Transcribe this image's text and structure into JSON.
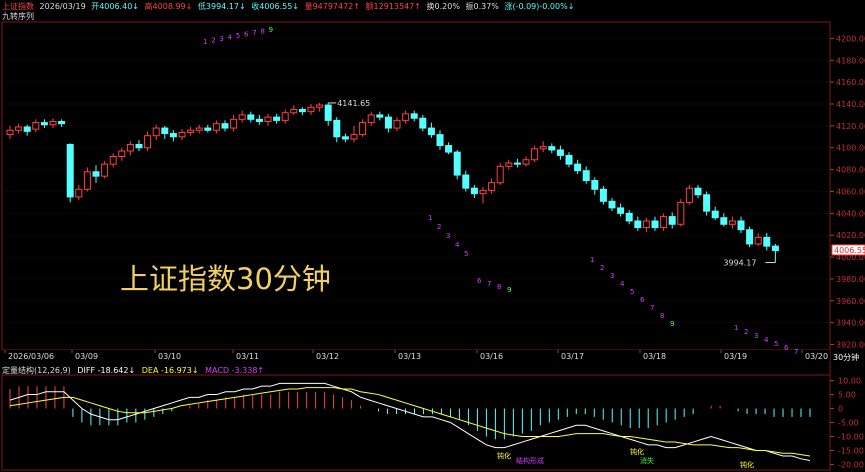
{
  "header": {
    "name": "上证指数",
    "date": "2026/03/19",
    "open": "开4006.40↓",
    "high": "高4008.99↓",
    "low": "低3994.17↓",
    "close": "收4006.55↓",
    "volume": "量94797472↑",
    "amount": "额12913547↑",
    "turnover": "换0.20%",
    "amplitude": "振0.37%",
    "change": "涨(-0.09)-0.00%↓"
  },
  "indicator_name": "九转序列",
  "overlay_title": "上证指数30分钟",
  "price_axis": [
    "4200.00",
    "4180.00",
    "4160.00",
    "4140.00",
    "4120.00",
    "4100.00",
    "4080.00",
    "4060.00",
    "4040.00",
    "4020.00",
    "4000.00",
    "3980.00",
    "3960.00",
    "3940.00",
    "3920.00"
  ],
  "current_price_tag": "4006.55",
  "high_label": "4141.65",
  "low_label": "3994.17",
  "date_axis": [
    "2026/03/06",
    "03/09",
    "03/10",
    "03/11",
    "03/12",
    "03/13",
    "03/16",
    "03/17",
    "03/18",
    "03/19",
    "03/20"
  ],
  "period_button": "30分钟",
  "macd": {
    "name": "定量结构(12,26,9)",
    "diff": "DIFF -18.642↓",
    "dea": "DEA -16.973↓",
    "macd": "MACD -3.338↑",
    "axis": [
      "10.00",
      "5.00",
      "0",
      "-5.00",
      "-10.00",
      "-15.00",
      "-20.00"
    ],
    "annotations": [
      "钝化",
      "结构形成",
      "钝化",
      "消失",
      "钝化"
    ]
  },
  "seq_digits": [
    "1",
    "2",
    "3",
    "4",
    "5",
    "6",
    "7",
    "8",
    "9"
  ],
  "colors": {
    "up": "#ff4040",
    "down": "#54ffff",
    "diff": "#ffffff",
    "dea": "#ffff40",
    "grid": "#7a1a1a",
    "axis_text": "#c03030",
    "seq_purple": "#d040ff",
    "seq_green": "#40ff40"
  },
  "chart_data": {
    "type": "candlestick",
    "y_range": [
      3915,
      4215
    ],
    "candles": [
      [
        4112,
        4116,
        4108,
        4120
      ],
      [
        4116,
        4119,
        4113,
        4122
      ],
      [
        4119,
        4115,
        4111,
        4121
      ],
      [
        4117,
        4123,
        4114,
        4126
      ],
      [
        4123,
        4121,
        4118,
        4126
      ],
      [
        4121,
        4124,
        4118,
        4127
      ],
      [
        4124,
        4122,
        4119,
        4126
      ],
      [
        4103,
        4055,
        4050,
        4104
      ],
      [
        4055,
        4062,
        4052,
        4066
      ],
      [
        4062,
        4078,
        4060,
        4082
      ],
      [
        4078,
        4074,
        4068,
        4084
      ],
      [
        4074,
        4085,
        4072,
        4088
      ],
      [
        4085,
        4092,
        4082,
        4095
      ],
      [
        4092,
        4097,
        4088,
        4100
      ],
      [
        4097,
        4103,
        4093,
        4106
      ],
      [
        4103,
        4100,
        4097,
        4107
      ],
      [
        4100,
        4111,
        4097,
        4115
      ],
      [
        4111,
        4118,
        4107,
        4121
      ],
      [
        4118,
        4113,
        4108,
        4120
      ],
      [
        4113,
        4110,
        4106,
        4116
      ],
      [
        4110,
        4114,
        4107,
        4117
      ],
      [
        4114,
        4116,
        4111,
        4119
      ],
      [
        4116,
        4118,
        4113,
        4121
      ],
      [
        4118,
        4116,
        4114,
        4121
      ],
      [
        4116,
        4122,
        4113,
        4125
      ],
      [
        4122,
        4118,
        4115,
        4125
      ],
      [
        4118,
        4126,
        4115,
        4130
      ],
      [
        4126,
        4130,
        4123,
        4134
      ],
      [
        4130,
        4126,
        4123,
        4133
      ],
      [
        4126,
        4124,
        4121,
        4130
      ],
      [
        4124,
        4128,
        4120,
        4131
      ],
      [
        4128,
        4125,
        4122,
        4131
      ],
      [
        4125,
        4132,
        4122,
        4135
      ],
      [
        4132,
        4135,
        4130,
        4139
      ],
      [
        4135,
        4133,
        4130,
        4137
      ],
      [
        4133,
        4137,
        4130,
        4140
      ],
      [
        4137,
        4139,
        4133,
        4141
      ],
      [
        4139,
        4125,
        4120,
        4141
      ],
      [
        4125,
        4110,
        4105,
        4128
      ],
      [
        4110,
        4108,
        4105,
        4113
      ],
      [
        4108,
        4112,
        4105,
        4120
      ],
      [
        4112,
        4123,
        4110,
        4126
      ],
      [
        4123,
        4130,
        4120,
        4133
      ],
      [
        4130,
        4128,
        4125,
        4133
      ],
      [
        4128,
        4118,
        4114,
        4131
      ],
      [
        4118,
        4125,
        4115,
        4128
      ],
      [
        4125,
        4131,
        4122,
        4134
      ],
      [
        4131,
        4127,
        4124,
        4134
      ],
      [
        4127,
        4118,
        4115,
        4130
      ],
      [
        4118,
        4112,
        4109,
        4123
      ],
      [
        4112,
        4102,
        4098,
        4116
      ],
      [
        4102,
        4096,
        4094,
        4105
      ],
      [
        4096,
        4075,
        4071,
        4098
      ],
      [
        4075,
        4063,
        4060,
        4079
      ],
      [
        4063,
        4058,
        4054,
        4066
      ],
      [
        4058,
        4061,
        4049,
        4064
      ],
      [
        4061,
        4068,
        4058,
        4072
      ],
      [
        4068,
        4083,
        4066,
        4086
      ],
      [
        4083,
        4086,
        4080,
        4089
      ],
      [
        4086,
        4085,
        4082,
        4090
      ],
      [
        4085,
        4089,
        4083,
        4092
      ],
      [
        4089,
        4099,
        4087,
        4102
      ],
      [
        4099,
        4101,
        4096,
        4106
      ],
      [
        4101,
        4098,
        4095,
        4104
      ],
      [
        4098,
        4093,
        4089,
        4102
      ],
      [
        4093,
        4085,
        4082,
        4096
      ],
      [
        4085,
        4079,
        4076,
        4089
      ],
      [
        4079,
        4070,
        4067,
        4083
      ],
      [
        4070,
        4062,
        4057,
        4073
      ],
      [
        4062,
        4051,
        4048,
        4065
      ],
      [
        4051,
        4045,
        4042,
        4054
      ],
      [
        4045,
        4040,
        4037,
        4049
      ],
      [
        4040,
        4033,
        4030,
        4043
      ],
      [
        4033,
        4027,
        4024,
        4037
      ],
      [
        4027,
        4033,
        4023,
        4036
      ],
      [
        4033,
        4027,
        4024,
        4037
      ],
      [
        4027,
        4037,
        4024,
        4040
      ],
      [
        4037,
        4030,
        4026,
        4041
      ],
      [
        4030,
        4050,
        4028,
        4053
      ],
      [
        4050,
        4063,
        4048,
        4066
      ],
      [
        4063,
        4057,
        4054,
        4066
      ],
      [
        4057,
        4042,
        4038,
        4060
      ],
      [
        4042,
        4036,
        4034,
        4046
      ],
      [
        4036,
        4030,
        4028,
        4040
      ],
      [
        4030,
        4033,
        4026,
        4037
      ],
      [
        4033,
        4025,
        4022,
        4037
      ],
      [
        4025,
        4012,
        4009,
        4028
      ],
      [
        4012,
        4018,
        4010,
        4022
      ],
      [
        4018,
        4010,
        4006,
        4022
      ],
      [
        4010,
        4006,
        3995,
        4012
      ]
    ],
    "seq_groups": [
      {
        "start_index": 29,
        "digits": 9,
        "y_price": 4200,
        "color_last": "green"
      },
      {
        "start_index": 68,
        "digits": 9,
        "y_price": 4028,
        "color_last": "green"
      },
      {
        "start_index": 95,
        "digits": 9,
        "y_price": 3992,
        "color_last": "green"
      },
      {
        "start_index": 131,
        "digits": 7,
        "y_price": 3938,
        "color_last": "purple"
      }
    ],
    "macd_hist": [
      7,
      8,
      8,
      8,
      8,
      8,
      8,
      -3,
      -5,
      -6,
      -6,
      -6,
      -6,
      -5,
      -5,
      -4,
      -3,
      -2,
      -1,
      0,
      1,
      2,
      3,
      3,
      4,
      4,
      5,
      5,
      5,
      5,
      6,
      6,
      6,
      6,
      6,
      6,
      5,
      4,
      3,
      1,
      0,
      -1,
      -2,
      -2,
      -2,
      -2,
      -2,
      -2,
      -2,
      -3,
      -4,
      -6,
      -8,
      -10,
      -11,
      -11,
      -10,
      -9,
      -8,
      -6,
      -5,
      -4,
      -3,
      -2,
      -2,
      -3,
      -4,
      -5,
      -6,
      -7,
      -7,
      -7,
      -6,
      -5,
      -4,
      -3,
      -2,
      0,
      1,
      1,
      0,
      -1,
      -2,
      -2,
      -2,
      -3,
      -3,
      -3,
      -3,
      -3
    ],
    "diff": [
      3,
      4,
      5,
      5,
      6,
      6,
      6,
      3,
      0,
      -2,
      -3,
      -4,
      -4,
      -3,
      -2,
      -1,
      0,
      1,
      2,
      3,
      4,
      4,
      5,
      5,
      6,
      6,
      7,
      7,
      8,
      8,
      9,
      9,
      9,
      9,
      9,
      9,
      8,
      7,
      6,
      4,
      3,
      2,
      1,
      0,
      -1,
      -2,
      -3,
      -3,
      -4,
      -5,
      -7,
      -9,
      -11,
      -13,
      -14,
      -14,
      -13,
      -12,
      -11,
      -10,
      -9,
      -8,
      -7,
      -6,
      -6,
      -7,
      -8,
      -9,
      -10,
      -11,
      -12,
      -13,
      -13,
      -14,
      -14,
      -13,
      -12,
      -11,
      -10,
      -11,
      -12,
      -13,
      -14,
      -15,
      -15,
      -16,
      -17,
      -17,
      -18,
      -18.6
    ],
    "dea": [
      1,
      1.5,
      2,
      2.5,
      3,
      3.5,
      4,
      4,
      3,
      2,
      1,
      0,
      -1,
      -1.5,
      -1.5,
      -1.5,
      -1,
      -0.5,
      0,
      1,
      1.5,
      2,
      2.5,
      3,
      3.5,
      4,
      4.5,
      5,
      5.5,
      6,
      6.5,
      7,
      7,
      7.5,
      7.5,
      7.5,
      7.5,
      7,
      7,
      6,
      5.5,
      5,
      4,
      3,
      2,
      1,
      0,
      -1,
      -2,
      -3,
      -4,
      -5,
      -6,
      -7,
      -8,
      -9,
      -9.5,
      -10,
      -10,
      -10,
      -10,
      -10,
      -9.5,
      -9,
      -9,
      -9,
      -9,
      -9.5,
      -10,
      -10,
      -10.5,
      -11,
      -11.5,
      -12,
      -12,
      -12.5,
      -13,
      -13,
      -13,
      -13.5,
      -14,
      -14,
      -14.5,
      -15,
      -15,
      -15.5,
      -16,
      -16,
      -16.5,
      -17
    ]
  }
}
